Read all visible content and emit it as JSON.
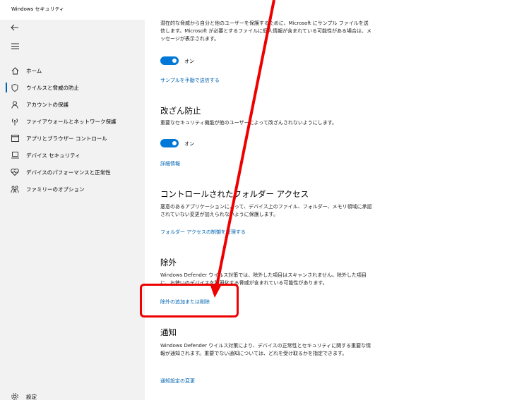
{
  "window": {
    "title": "Windows セキュリティ",
    "minimize": "–",
    "maximize": "☐",
    "close": "✕"
  },
  "sidebar": {
    "back_icon": "back-arrow-icon",
    "menu_icon": "hamburger-icon",
    "items": [
      {
        "label": "ホーム",
        "icon": "home-icon"
      },
      {
        "label": "ウイルスと脅威の防止",
        "icon": "shield-icon",
        "active": true
      },
      {
        "label": "アカウントの保護",
        "icon": "person-icon"
      },
      {
        "label": "ファイアウォールとネットワーク保護",
        "icon": "antenna-icon"
      },
      {
        "label": "アプリとブラウザー コントロール",
        "icon": "window-icon"
      },
      {
        "label": "デバイス セキュリティ",
        "icon": "laptop-icon"
      },
      {
        "label": "デバイスのパフォーマンスと正常性",
        "icon": "heart-icon"
      },
      {
        "label": "ファミリーのオプション",
        "icon": "family-icon"
      }
    ],
    "settings": {
      "label": "設定",
      "icon": "gear-icon"
    }
  },
  "main": {
    "sample": {
      "desc": "潜在的な脅威から自分と他のユーザーを保護するために、Microsoft にサンプル ファイルを送信します。Microsoft が必要とするファイルに個人情報が含まれている可能性がある場合は、メッセージが表示されます。",
      "toggle_label": "オン",
      "link": "サンプルを手動で送信する"
    },
    "tamper": {
      "title": "改ざん防止",
      "desc": "重要なセキュリティ機能が他のユーザーによって改ざんされないようにします。",
      "toggle_label": "オン",
      "link": "詳細情報"
    },
    "folder": {
      "title": "コントロールされたフォルダー アクセス",
      "desc": "悪意のあるアプリケーションによって、デバイス上のファイル、フォルダー、メモリ領域に承認されていない変更が加えられないように保護します。",
      "link": "フォルダー アクセスの制御を管理する"
    },
    "exclusions": {
      "title": "除外",
      "desc": "Windows Defender ウイルス対策では、除外した項目はスキャンされません。除外した項目に、お使いのデバイスを脆弱化する脅威が含まれている可能性があります。",
      "link": "除外の追加または削除"
    },
    "notifications": {
      "title": "通知",
      "desc": "Windows Defender ウイルス対策により、デバイスの正常性とセキュリティに関する重要な情報が通知されます。重要でない通知については、どれを受け取るかを指定できます。",
      "link": "通知設定の変更"
    }
  },
  "colors": {
    "accent": "#0078d7",
    "link": "#0063b1",
    "annotation": "#e00000"
  }
}
